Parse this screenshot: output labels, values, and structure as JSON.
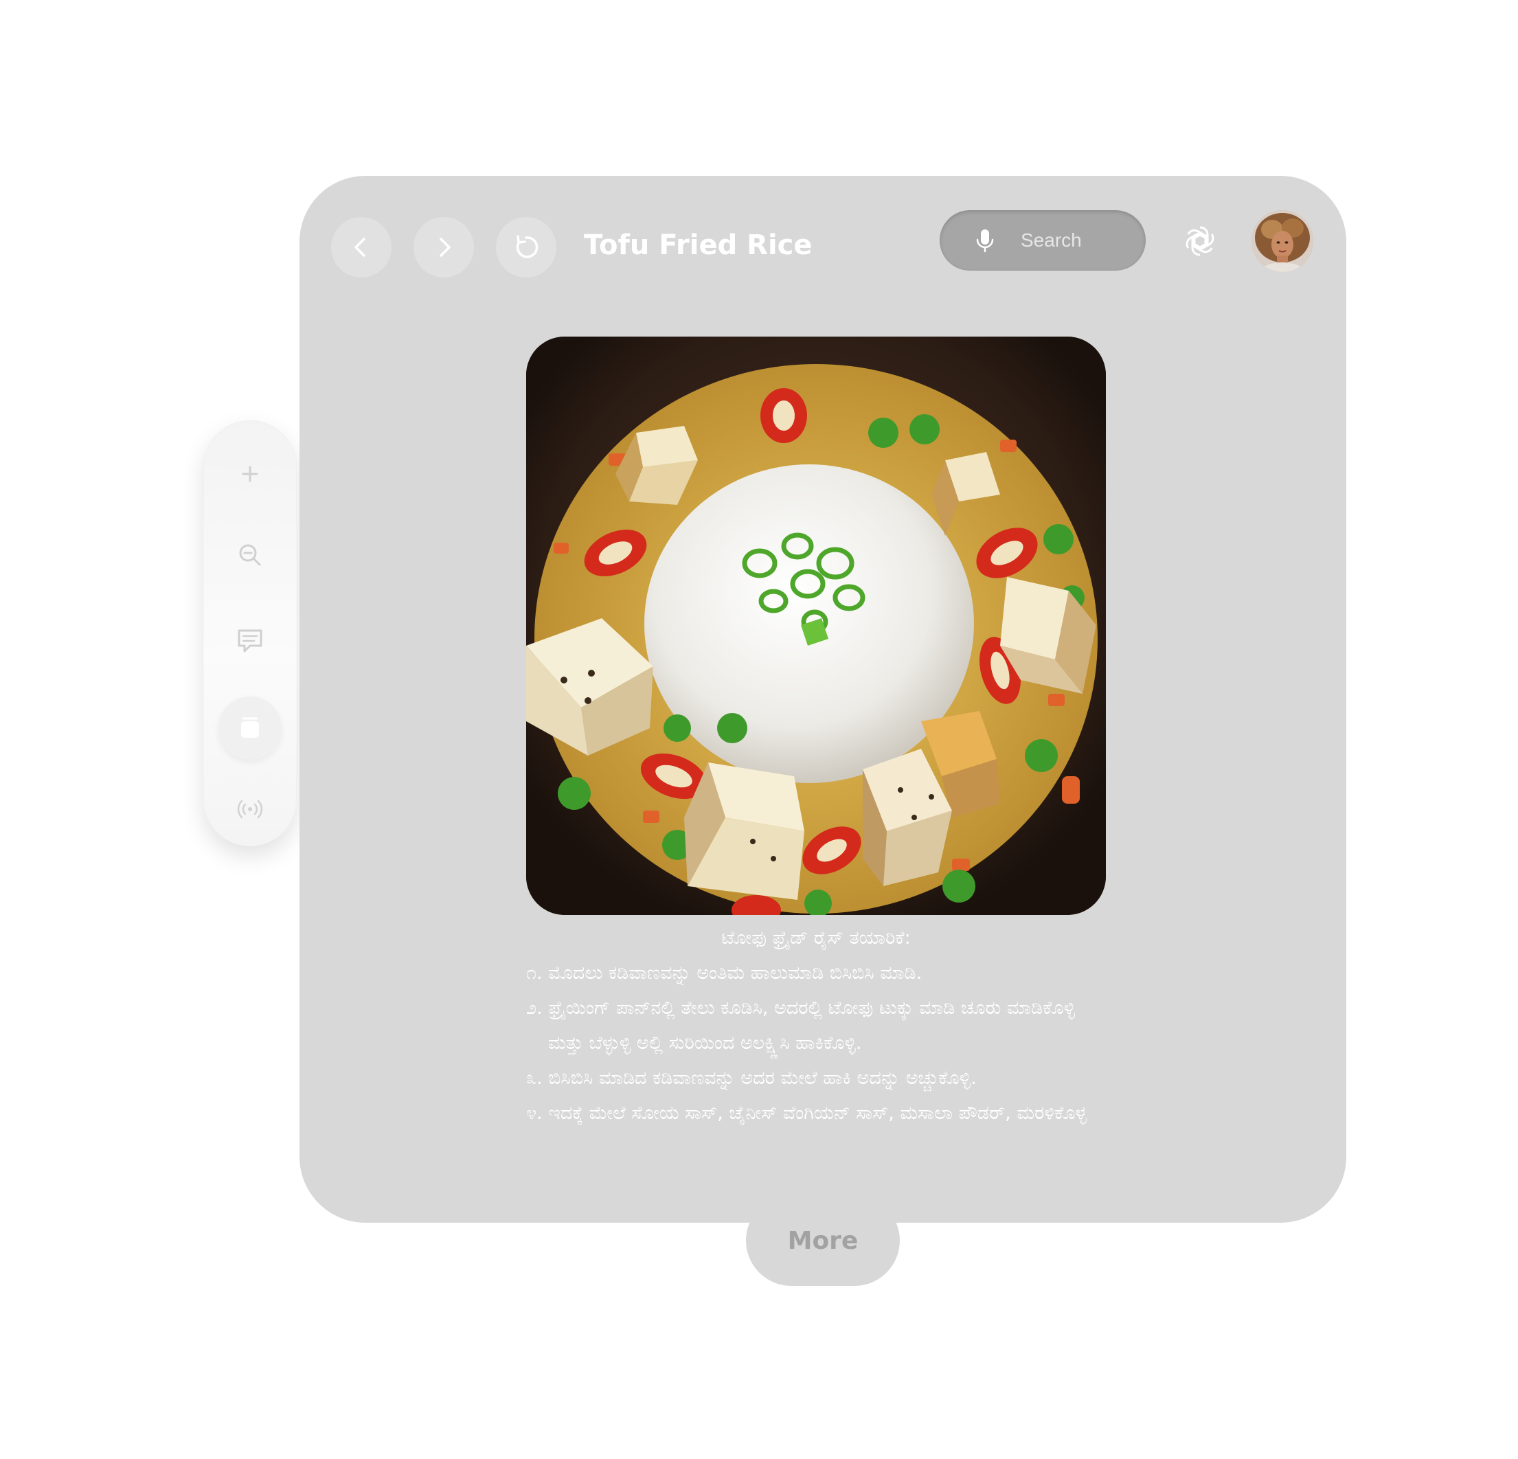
{
  "window": {
    "title": "Tofu Fried Rice"
  },
  "nav": {
    "back_icon": "chevron-left-icon",
    "forward_icon": "chevron-right-icon",
    "reload_icon": "reload-icon"
  },
  "search": {
    "placeholder": "Search",
    "icon": "microphone-icon"
  },
  "toolbar_right": {
    "assistant_icon": "openai-icon",
    "avatar_icon": "user-avatar"
  },
  "content": {
    "image_subject": "tofu fried rice dish",
    "recipe_title": "ಟೋಫು ಫ್ರೈಡ್ ರೈಸ್ ತಯಾರಿಕೆ:",
    "steps": [
      "೧. ಮೊದಲು ಕಡಿವಾಣವನ್ನು ಅಂತಿಮ ಹಾಲುಮಾಡಿ ಬಿಸಿಬಿಸಿ ಮಾಡಿ.",
      "೨. ಫ್ರೈಯಿಂಗ್ ಪಾನ್‌ನಲ್ಲಿ ತೇಲು ಕೂಡಿಸಿ, ಅದರಲ್ಲಿ ಟೋಫು ಟುಕ್ಕು ಮಾಡಿ ಚೂರು ಮಾಡಿಕೊಳ್ಳಿ",
      "ಮತ್ತು ಬೆಳ್ಳುಳ್ಳಿ ಅಲ್ಲಿ ಸುರಿಯಿಂದ ಅಲಕ್ಷ್ಣಿಸಿ ಹಾಕಿಕೊಳ್ಳಿ.",
      "೩. ಬಿಸಿಬಿಸಿ ಮಾಡಿದ ಕಡಿವಾಣವನ್ನು ಅದರ ಮೇಲೆ ಹಾಕಿ ಅದನ್ನು ಅಚ್ಚುಕೊಳ್ಳಿ.",
      "೪. ಇದಕ್ಕೆ ಮೇಲೆ ಸೋಯ ಸಾಸ್, ಚೈನೀಸ್ ವೆಂಗಿಯನ್ ಸಾಸ್, ಮಸಾಲಾ ಪೌಡರ್, ಮರಳಿಕೊಳ್ಳ"
    ]
  },
  "more_button": {
    "label": "More"
  },
  "side_toolbar": {
    "items": [
      {
        "icon": "zoom-in-icon"
      },
      {
        "icon": "zoom-out-icon"
      },
      {
        "icon": "chat-icon"
      },
      {
        "icon": "window-icon",
        "active": true
      },
      {
        "icon": "broadcast-icon"
      }
    ]
  },
  "colors": {
    "window_bg": "#d8d8d8",
    "nav_button_bg": "#e1e1e1",
    "search_bg": "#a6a6a6",
    "text": "#ffffff",
    "more_text": "#a2a2a2"
  }
}
